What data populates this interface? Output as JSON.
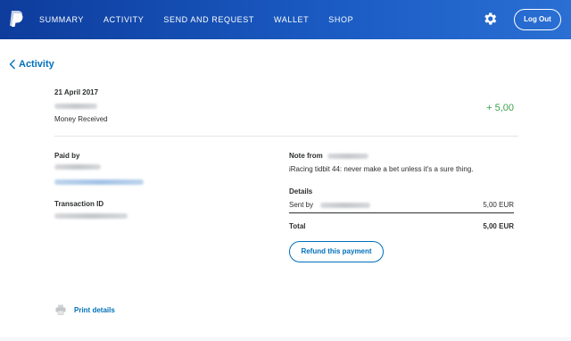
{
  "nav": {
    "items": [
      "SUMMARY",
      "ACTIVITY",
      "SEND AND REQUEST",
      "WALLET",
      "SHOP"
    ],
    "logout_label": "Log Out"
  },
  "back_label": "Activity",
  "transaction": {
    "date": "21 April 2017",
    "type": "Money Received",
    "amount": "+ 5,00"
  },
  "paid_by": {
    "label": "Paid by"
  },
  "transaction_id": {
    "label": "Transaction ID"
  },
  "note": {
    "label": "Note from",
    "text": "iRacing tidbit 44: never make a bet unless it's a sure thing."
  },
  "details": {
    "label": "Details",
    "sent_label": "Sent by",
    "sent_value": "5,00 EUR",
    "total_label": "Total",
    "total_value": "5,00 EUR"
  },
  "refund_label": "Refund this payment",
  "print_label": "Print details",
  "colors": {
    "brand": "#0070ba",
    "header": "#1b5cc4",
    "amount_positive": "#3aa34a"
  },
  "icons": [
    "paypal-logo-icon",
    "gear-icon",
    "chevron-left-icon",
    "printer-icon"
  ]
}
